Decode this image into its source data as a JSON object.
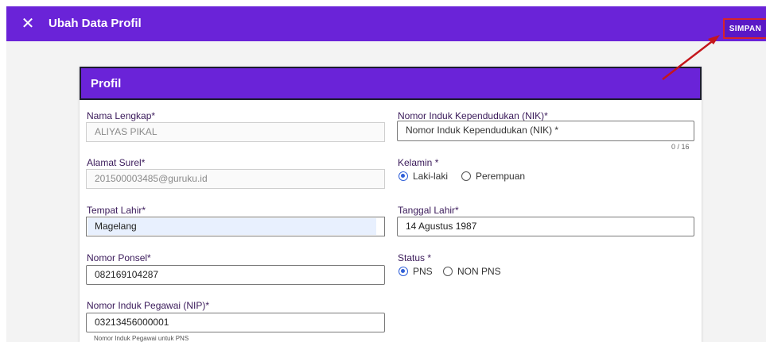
{
  "header": {
    "title": "Ubah Data Profil",
    "save_label": "SIMPAN",
    "close_icon": "close-icon"
  },
  "card": {
    "title": "Profil"
  },
  "form": {
    "nama": {
      "label": "Nama Lengkap*",
      "value": "ALIYAS PIKAL"
    },
    "nik": {
      "label": "Nomor Induk Kependudukan (NIK)*",
      "placeholder": "Nomor Induk Kependudukan (NIK) *",
      "counter": "0 / 16"
    },
    "surel": {
      "label": "Alamat Surel*",
      "value": "201500003485@guruku.id"
    },
    "kelamin": {
      "label": "Kelamin *",
      "options": [
        "Laki-laki",
        "Perempuan"
      ],
      "selected": "Laki-laki"
    },
    "tempat": {
      "label": "Tempat Lahir*",
      "value": "Magelang"
    },
    "tanggal": {
      "label": "Tanggal Lahir*",
      "value": "14 Agustus 1987"
    },
    "ponsel": {
      "label": "Nomor Ponsel*",
      "value": "082169104287"
    },
    "status": {
      "label": "Status *",
      "options": [
        "PNS",
        "NON PNS"
      ],
      "selected": "PNS"
    },
    "nip": {
      "label": "Nomor Induk Pegawai (NIP)*",
      "value": "03213456000001",
      "helper": "Nomor Induk Pegawai untuk PNS"
    }
  },
  "colors": {
    "brand": "#6a23d8",
    "highlight": "#d8232a",
    "radio": "#2f5fd8"
  }
}
